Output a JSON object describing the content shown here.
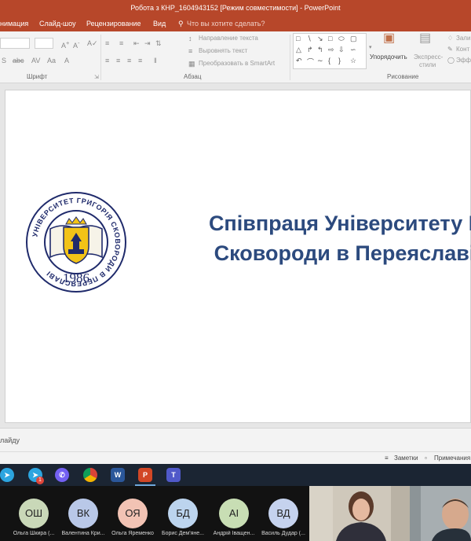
{
  "window": {
    "title": "Робота з КНР_1604943152 [Режим совместимости]  -  PowerPoint"
  },
  "menu_tabs": [
    "нимация",
    "Слайд-шоу",
    "Рецензирование",
    "Вид"
  ],
  "tell_me": "Что вы хотите сделать?",
  "ribbon": {
    "font_group": "Шрифт",
    "paragraph_group": "Абзац",
    "drawing_group": "Рисование",
    "text_direction": "Направление текста",
    "align_text": "Выровнять текст",
    "smartart": "Преобразовать в SmartArt",
    "arrange": "Упорядочить",
    "quick_styles_1": "Экспресс-",
    "quick_styles_2": "стили",
    "fill": "Зали",
    "outline": "Конт",
    "effects": "Эфф"
  },
  "slide": {
    "title_line1": "Співпраця Університету Г",
    "title_line2": "Сковороди в Переяславі",
    "logo": {
      "ring_text": "УНІВЕРСИТЕТ ГРИГОРІЯ СКОВОРОДИ В ПЕРЕЯСЛАВІ",
      "year": "1986",
      "colors": {
        "navy": "#1f2a6b",
        "gold": "#f2c317"
      }
    }
  },
  "notes_placeholder": "лайду",
  "status": {
    "notes": "Заметки",
    "comments": "Примечания"
  },
  "taskbar": {
    "apps": [
      "telegram-icon",
      "telegram-badge-icon",
      "viber-icon",
      "chrome-icon",
      "word-icon",
      "powerpoint-icon",
      "teams-icon"
    ],
    "telegram_badge": "1"
  },
  "participants": [
    {
      "initials": "ОШ",
      "name": "Ольга Шкира (...",
      "color": "#c9d8b8"
    },
    {
      "initials": "ВК",
      "name": "Валентина Кри...",
      "color": "#b9c8e8"
    },
    {
      "initials": "ОЯ",
      "name": "Ольга Яременко",
      "color": "#f2c3b4"
    },
    {
      "initials": "БД",
      "name": "Борис Дем'яне...",
      "color": "#bcd4ee"
    },
    {
      "initials": "АІ",
      "name": "Андрій Іващен...",
      "color": "#c8deb4"
    },
    {
      "initials": "ВД",
      "name": "Василь Дудар (...",
      "color": "#c5d2ee"
    }
  ],
  "first_participant_name": "..."
}
